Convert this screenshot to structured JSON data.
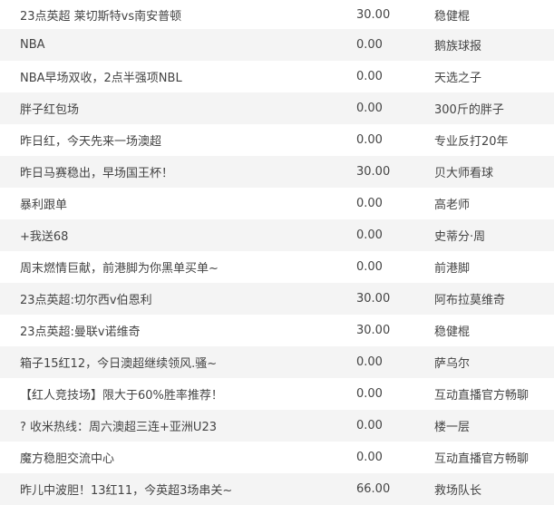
{
  "items": [
    {
      "title": "23点英超 莱切斯特vs南安普顿",
      "price": "30.00",
      "author": "稳健棍"
    },
    {
      "title": "NBA",
      "price": "0.00",
      "author": "鹅族球报"
    },
    {
      "title": "NBA早场双收，2点半强项NBL",
      "price": "0.00",
      "author": "天选之子"
    },
    {
      "title": "胖子红包场",
      "price": "0.00",
      "author": "300斤的胖子"
    },
    {
      "title": "昨日红，今天先来一场澳超",
      "price": "0.00",
      "author": "专业反打20年"
    },
    {
      "title": "昨日马赛稳出，早场国王杯！",
      "price": "30.00",
      "author": "贝大师看球"
    },
    {
      "title": "暴利跟单",
      "price": "0.00",
      "author": "高老师"
    },
    {
      "title": "+我送68",
      "price": "0.00",
      "author": "史蒂分·周"
    },
    {
      "title": "周末燃情巨献，前港脚为你黑单买单~",
      "price": "0.00",
      "author": "前港脚"
    },
    {
      "title": "23点英超:切尔西v伯恩利",
      "price": "30.00",
      "author": "阿布拉莫维奇"
    },
    {
      "title": "23点英超:曼联v诺维奇",
      "price": "30.00",
      "author": "稳健棍"
    },
    {
      "title": "箱子15红12，今日澳超继续领风.骚~",
      "price": "0.00",
      "author": "萨乌尔"
    },
    {
      "title": "【红人竞技场】限大于60%胜率推荐！",
      "price": "0.00",
      "author": "互动直播官方畅聊"
    },
    {
      "title": "? 收米热线：周六澳超三连+亚洲U23",
      "price": "0.00",
      "author": "楼一层"
    },
    {
      "title": "魔方稳胆交流中心",
      "price": "0.00",
      "author": "互动直播官方畅聊"
    },
    {
      "title": "昨儿中波胆！13红11，今英超3场串关~",
      "price": "66.00",
      "author": "救场队长"
    }
  ]
}
